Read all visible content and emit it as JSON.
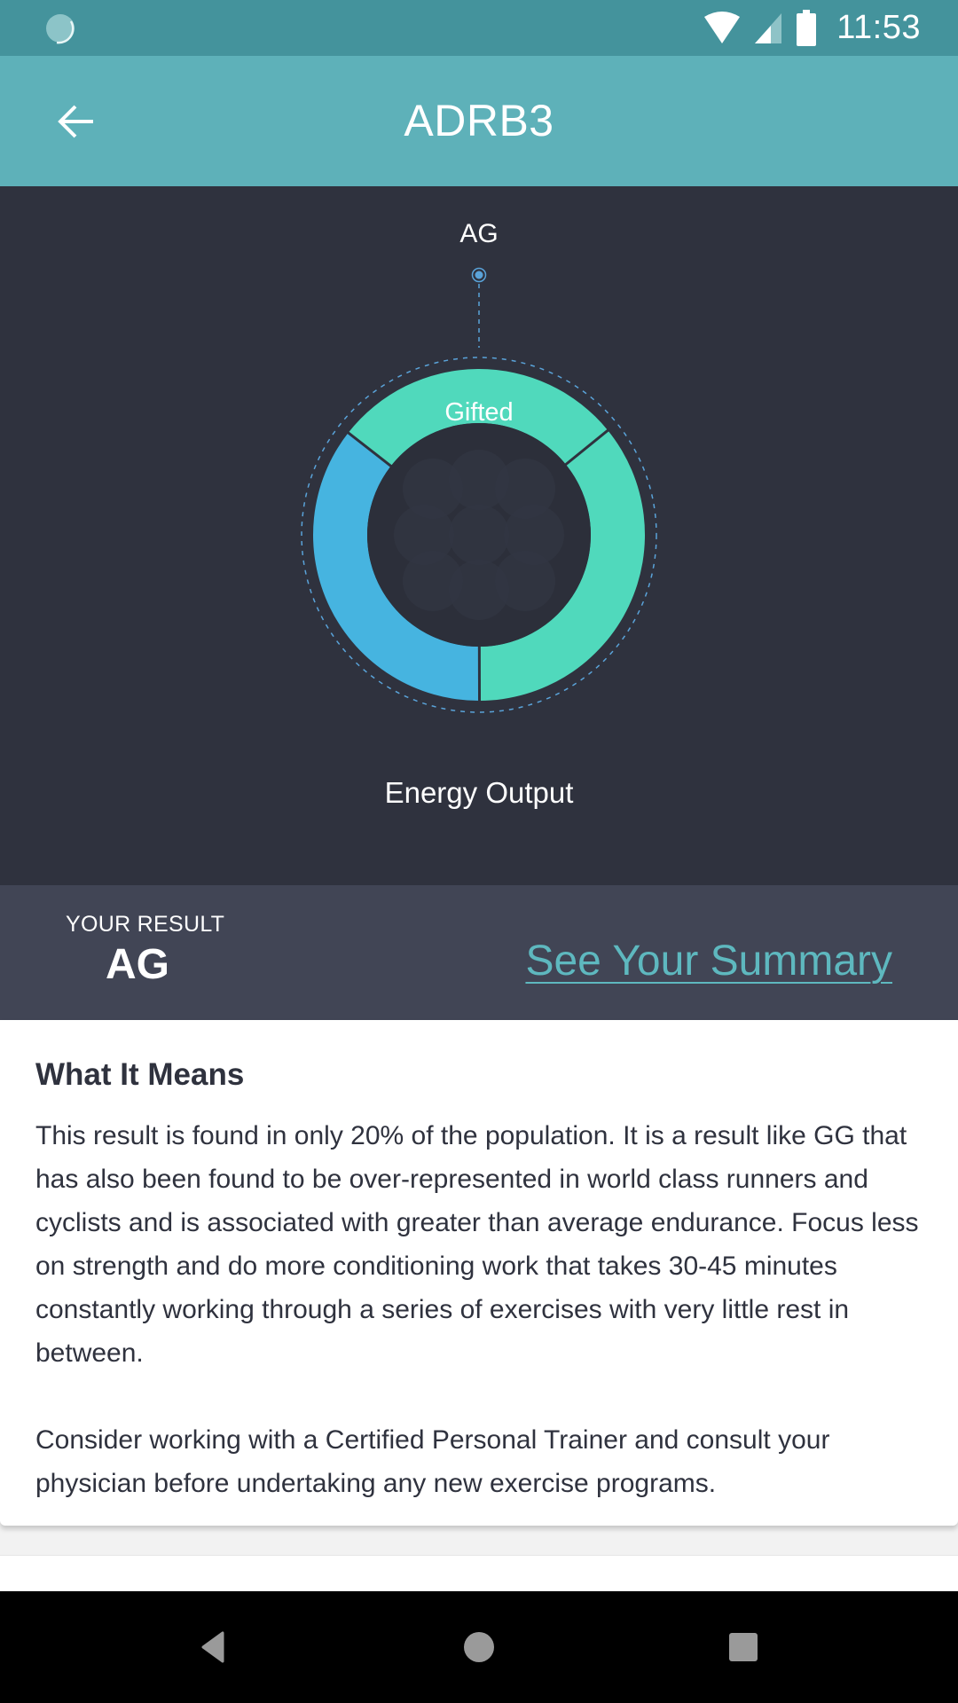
{
  "status_bar": {
    "time": "11:53",
    "icons": [
      "loading-spinner-icon",
      "wifi-icon",
      "signal-icon",
      "battery-icon"
    ]
  },
  "app_bar": {
    "title": "ADRB3",
    "back_icon": "arrow-left-icon"
  },
  "hero": {
    "genotype_label": "AG",
    "ring_label": "Gifted",
    "trait_label": "Energy Output",
    "colors": {
      "background": "#2f323e",
      "gifted": "#50d9bc",
      "other": "#46b4e0",
      "marker": "#5aa3d9"
    }
  },
  "chart_data": {
    "type": "pie",
    "title": "Energy Output",
    "style": "donut",
    "selected_marker": "AG",
    "highlight_label": "Gifted",
    "segments": [
      {
        "name": "top",
        "percent": 28.6,
        "color": "#50d9bc",
        "label": "Gifted"
      },
      {
        "name": "right",
        "percent": 35.8,
        "color": "#50d9bc",
        "label": ""
      },
      {
        "name": "left",
        "percent": 35.6,
        "color": "#46b4e0",
        "label": ""
      }
    ]
  },
  "result": {
    "caption": "YOUR RESULT",
    "value": "AG",
    "summary_link": "See Your Summary"
  },
  "card": {
    "title": "What It Means",
    "paragraphs": [
      "This result is found in only 20% of the population. It is a result like GG that has also been found to be over-represented in world class runners and cyclists and is associated with greater than average endurance.  Focus less on strength and do more conditioning work that takes 30-45 minutes constantly working through a series of exercises with very little rest in between.",
      "Consider working with a Certified Personal Trainer and consult your physician before undertaking any new exercise programs."
    ]
  },
  "nav_bar": {
    "buttons": [
      "back-triangle-icon",
      "home-circle-icon",
      "recents-square-icon"
    ]
  }
}
